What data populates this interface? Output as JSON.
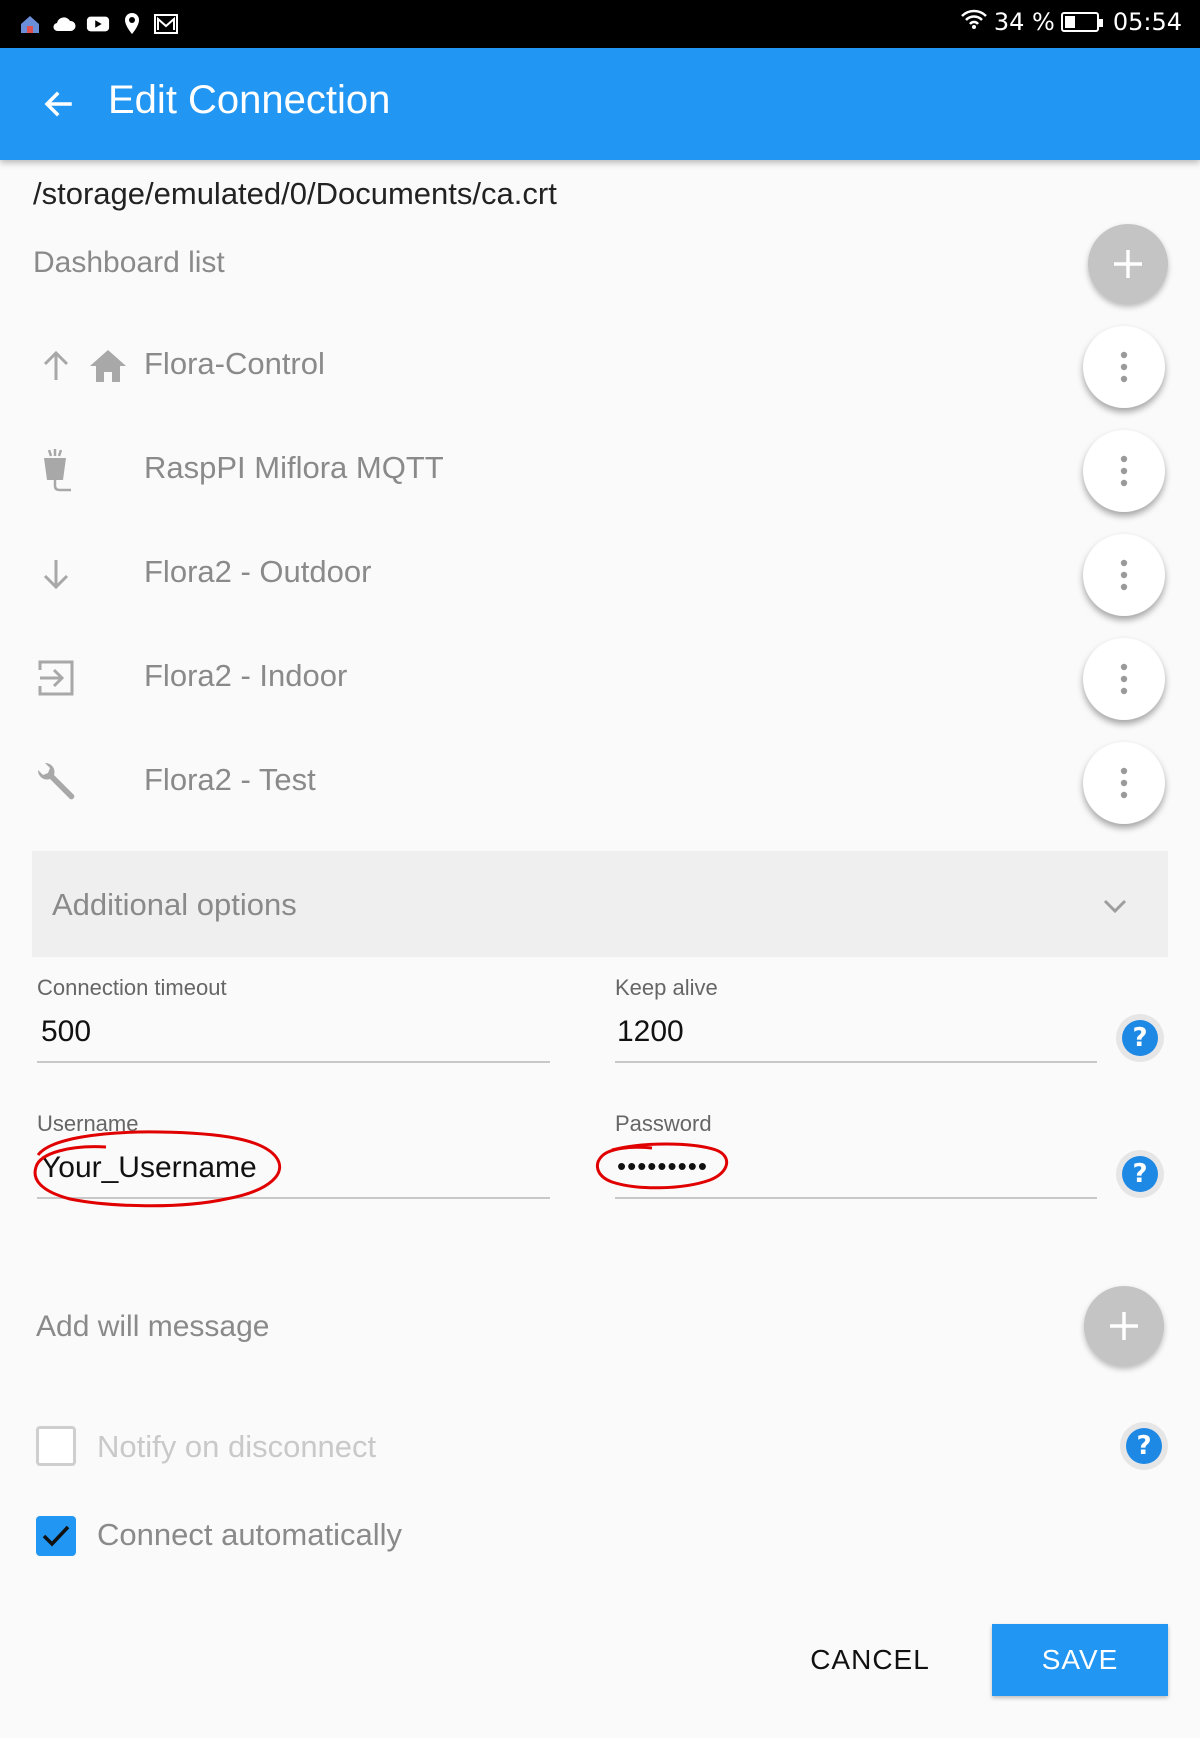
{
  "status_bar": {
    "battery_percent": "34 %",
    "battery_level": 0.34,
    "time": "05:54",
    "left_icons": [
      "home-icon",
      "cloud-icon",
      "youtube-icon",
      "location-icon",
      "gmail-icon"
    ]
  },
  "app_bar": {
    "title": "Edit Connection",
    "back_icon": "arrow-back-icon",
    "color": "#2196f3"
  },
  "certificate_path": "/storage/emulated/0/Documents/ca.crt",
  "dashboard_list": {
    "label": "Dashboard list",
    "add_icon": "plus-icon",
    "items": [
      {
        "label": "Flora-Control",
        "order_icon": "arrow-up-icon",
        "is_home": true
      },
      {
        "label": "RaspPI Miflora MQTT",
        "order_icon": "plant-icon",
        "is_home": false
      },
      {
        "label": "Flora2 - Outdoor",
        "order_icon": "arrow-down-icon",
        "is_home": false
      },
      {
        "label": "Flora2 - Indoor",
        "order_icon": "login-icon",
        "is_home": false
      },
      {
        "label": "Flora2 - Test",
        "order_icon": "wrench-icon",
        "is_home": false
      }
    ],
    "menu_icon": "more-vert-icon"
  },
  "additional_options": {
    "label": "Additional options",
    "chevron_icon": "chevron-down-icon"
  },
  "fields": {
    "connection_timeout": {
      "label": "Connection timeout",
      "value": "500"
    },
    "keep_alive": {
      "label": "Keep alive",
      "value": "1200"
    },
    "username": {
      "label": "Username",
      "value": "Your_Username"
    },
    "password": {
      "label": "Password",
      "value": "•••••••••"
    }
  },
  "will_message": {
    "label": "Add will message",
    "add_icon": "plus-icon"
  },
  "options": {
    "notify_on_disconnect": {
      "label": "Notify on disconnect",
      "checked": false
    },
    "connect_automatically": {
      "label": "Connect automatically",
      "checked": true
    }
  },
  "actions": {
    "cancel": "CANCEL",
    "save": "SAVE"
  },
  "colors": {
    "accent": "#2196f3",
    "help": "#1e88e5",
    "annotation": "#e00000"
  }
}
